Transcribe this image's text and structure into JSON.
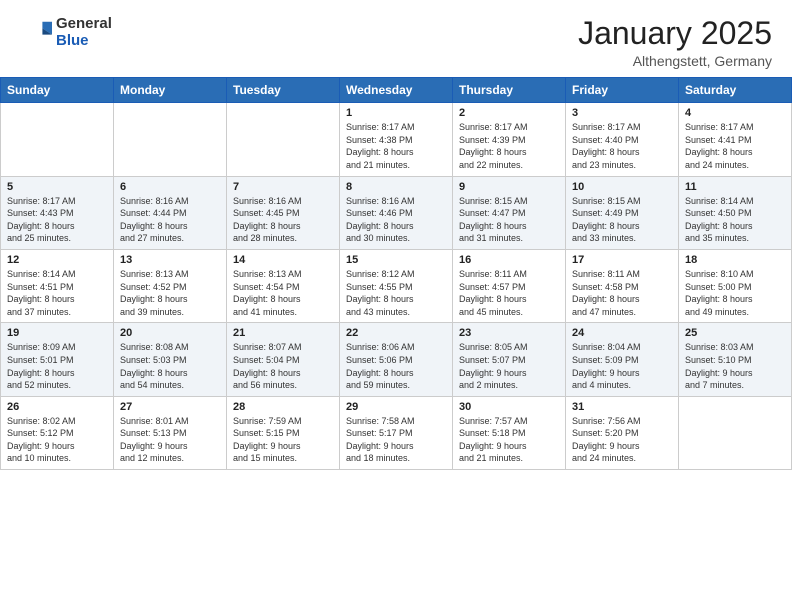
{
  "header": {
    "logo_general": "General",
    "logo_blue": "Blue",
    "month_year": "January 2025",
    "location": "Althengstett, Germany"
  },
  "weekdays": [
    "Sunday",
    "Monday",
    "Tuesday",
    "Wednesday",
    "Thursday",
    "Friday",
    "Saturday"
  ],
  "weeks": [
    [
      {
        "day": "",
        "info": ""
      },
      {
        "day": "",
        "info": ""
      },
      {
        "day": "",
        "info": ""
      },
      {
        "day": "1",
        "info": "Sunrise: 8:17 AM\nSunset: 4:38 PM\nDaylight: 8 hours\nand 21 minutes."
      },
      {
        "day": "2",
        "info": "Sunrise: 8:17 AM\nSunset: 4:39 PM\nDaylight: 8 hours\nand 22 minutes."
      },
      {
        "day": "3",
        "info": "Sunrise: 8:17 AM\nSunset: 4:40 PM\nDaylight: 8 hours\nand 23 minutes."
      },
      {
        "day": "4",
        "info": "Sunrise: 8:17 AM\nSunset: 4:41 PM\nDaylight: 8 hours\nand 24 minutes."
      }
    ],
    [
      {
        "day": "5",
        "info": "Sunrise: 8:17 AM\nSunset: 4:43 PM\nDaylight: 8 hours\nand 25 minutes."
      },
      {
        "day": "6",
        "info": "Sunrise: 8:16 AM\nSunset: 4:44 PM\nDaylight: 8 hours\nand 27 minutes."
      },
      {
        "day": "7",
        "info": "Sunrise: 8:16 AM\nSunset: 4:45 PM\nDaylight: 8 hours\nand 28 minutes."
      },
      {
        "day": "8",
        "info": "Sunrise: 8:16 AM\nSunset: 4:46 PM\nDaylight: 8 hours\nand 30 minutes."
      },
      {
        "day": "9",
        "info": "Sunrise: 8:15 AM\nSunset: 4:47 PM\nDaylight: 8 hours\nand 31 minutes."
      },
      {
        "day": "10",
        "info": "Sunrise: 8:15 AM\nSunset: 4:49 PM\nDaylight: 8 hours\nand 33 minutes."
      },
      {
        "day": "11",
        "info": "Sunrise: 8:14 AM\nSunset: 4:50 PM\nDaylight: 8 hours\nand 35 minutes."
      }
    ],
    [
      {
        "day": "12",
        "info": "Sunrise: 8:14 AM\nSunset: 4:51 PM\nDaylight: 8 hours\nand 37 minutes."
      },
      {
        "day": "13",
        "info": "Sunrise: 8:13 AM\nSunset: 4:52 PM\nDaylight: 8 hours\nand 39 minutes."
      },
      {
        "day": "14",
        "info": "Sunrise: 8:13 AM\nSunset: 4:54 PM\nDaylight: 8 hours\nand 41 minutes."
      },
      {
        "day": "15",
        "info": "Sunrise: 8:12 AM\nSunset: 4:55 PM\nDaylight: 8 hours\nand 43 minutes."
      },
      {
        "day": "16",
        "info": "Sunrise: 8:11 AM\nSunset: 4:57 PM\nDaylight: 8 hours\nand 45 minutes."
      },
      {
        "day": "17",
        "info": "Sunrise: 8:11 AM\nSunset: 4:58 PM\nDaylight: 8 hours\nand 47 minutes."
      },
      {
        "day": "18",
        "info": "Sunrise: 8:10 AM\nSunset: 5:00 PM\nDaylight: 8 hours\nand 49 minutes."
      }
    ],
    [
      {
        "day": "19",
        "info": "Sunrise: 8:09 AM\nSunset: 5:01 PM\nDaylight: 8 hours\nand 52 minutes."
      },
      {
        "day": "20",
        "info": "Sunrise: 8:08 AM\nSunset: 5:03 PM\nDaylight: 8 hours\nand 54 minutes."
      },
      {
        "day": "21",
        "info": "Sunrise: 8:07 AM\nSunset: 5:04 PM\nDaylight: 8 hours\nand 56 minutes."
      },
      {
        "day": "22",
        "info": "Sunrise: 8:06 AM\nSunset: 5:06 PM\nDaylight: 8 hours\nand 59 minutes."
      },
      {
        "day": "23",
        "info": "Sunrise: 8:05 AM\nSunset: 5:07 PM\nDaylight: 9 hours\nand 2 minutes."
      },
      {
        "day": "24",
        "info": "Sunrise: 8:04 AM\nSunset: 5:09 PM\nDaylight: 9 hours\nand 4 minutes."
      },
      {
        "day": "25",
        "info": "Sunrise: 8:03 AM\nSunset: 5:10 PM\nDaylight: 9 hours\nand 7 minutes."
      }
    ],
    [
      {
        "day": "26",
        "info": "Sunrise: 8:02 AM\nSunset: 5:12 PM\nDaylight: 9 hours\nand 10 minutes."
      },
      {
        "day": "27",
        "info": "Sunrise: 8:01 AM\nSunset: 5:13 PM\nDaylight: 9 hours\nand 12 minutes."
      },
      {
        "day": "28",
        "info": "Sunrise: 7:59 AM\nSunset: 5:15 PM\nDaylight: 9 hours\nand 15 minutes."
      },
      {
        "day": "29",
        "info": "Sunrise: 7:58 AM\nSunset: 5:17 PM\nDaylight: 9 hours\nand 18 minutes."
      },
      {
        "day": "30",
        "info": "Sunrise: 7:57 AM\nSunset: 5:18 PM\nDaylight: 9 hours\nand 21 minutes."
      },
      {
        "day": "31",
        "info": "Sunrise: 7:56 AM\nSunset: 5:20 PM\nDaylight: 9 hours\nand 24 minutes."
      },
      {
        "day": "",
        "info": ""
      }
    ]
  ]
}
